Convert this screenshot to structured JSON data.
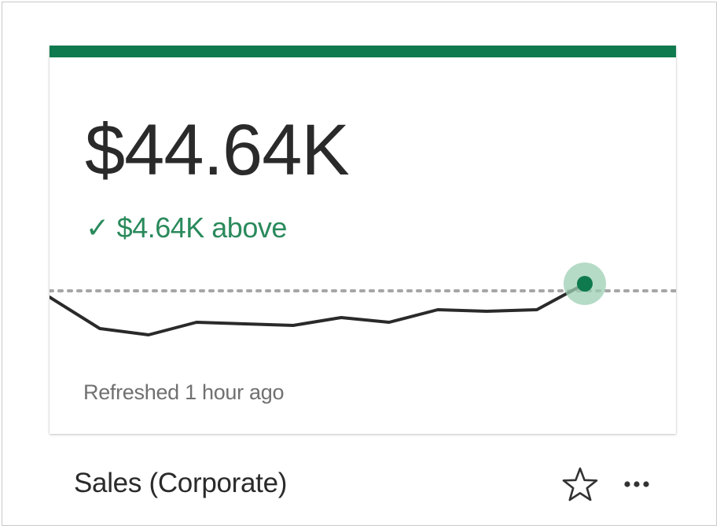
{
  "card": {
    "metric_value": "$44.64K",
    "comparison": {
      "icon": "check-icon",
      "check_glyph": "✓",
      "text": "$4.64K above"
    },
    "refreshed": "Refreshed 1 hour ago",
    "title": "Sales (Corporate)",
    "accent_color": "#0e7a4d",
    "positive_color": "#2a8a5c"
  },
  "actions": {
    "favorite_icon": "star-outline-icon",
    "more_icon": "more-horizontal-icon"
  }
}
